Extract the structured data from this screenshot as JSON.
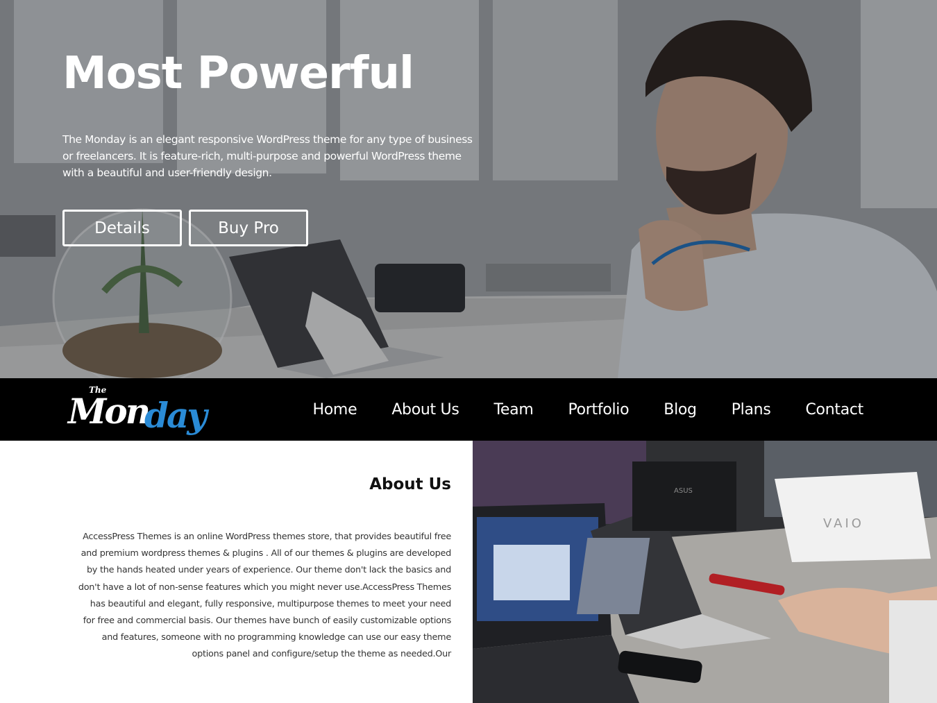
{
  "hero": {
    "title": "Most Powerful",
    "description": "The Monday is an elegant responsive WordPress theme for any type of business or freelancers. It is feature-rich, multi-purpose and powerful WordPress theme with a beautiful and user-friendly design.",
    "buttons": {
      "details": "Details",
      "buy_pro": "Buy Pro"
    }
  },
  "brand": {
    "the": "The",
    "mon": "Mon",
    "day": "day",
    "accent_color": "#2a8bd6"
  },
  "nav": {
    "items": [
      {
        "label": "Home"
      },
      {
        "label": "About Us"
      },
      {
        "label": "Team"
      },
      {
        "label": "Portfolio"
      },
      {
        "label": "Blog"
      },
      {
        "label": "Plans"
      },
      {
        "label": "Contact"
      }
    ]
  },
  "about": {
    "title": "About Us",
    "text": "AccessPress Themes is an online WordPress themes store, that provides beautiful free and premium wordpress themes & plugins . All of our themes & plugins are developed by the hands heated under years of experience. Our theme don't lack the basics and don't have a lot of non-sense features which you might never use.AccessPress Themes has beautiful and elegant, fully responsive, multipurpose themes to meet your need for free and commercial basis. Our themes have bunch of easily customizable options and features, someone with no programming knowledge can use our easy theme options panel and configure/setup the theme as needed.Our"
  },
  "photo_labels": {
    "laptop_brand": "VAIO"
  },
  "colors": {
    "navbar_bg": "#000000",
    "hero_text": "#ffffff",
    "about_title": "#111111"
  }
}
